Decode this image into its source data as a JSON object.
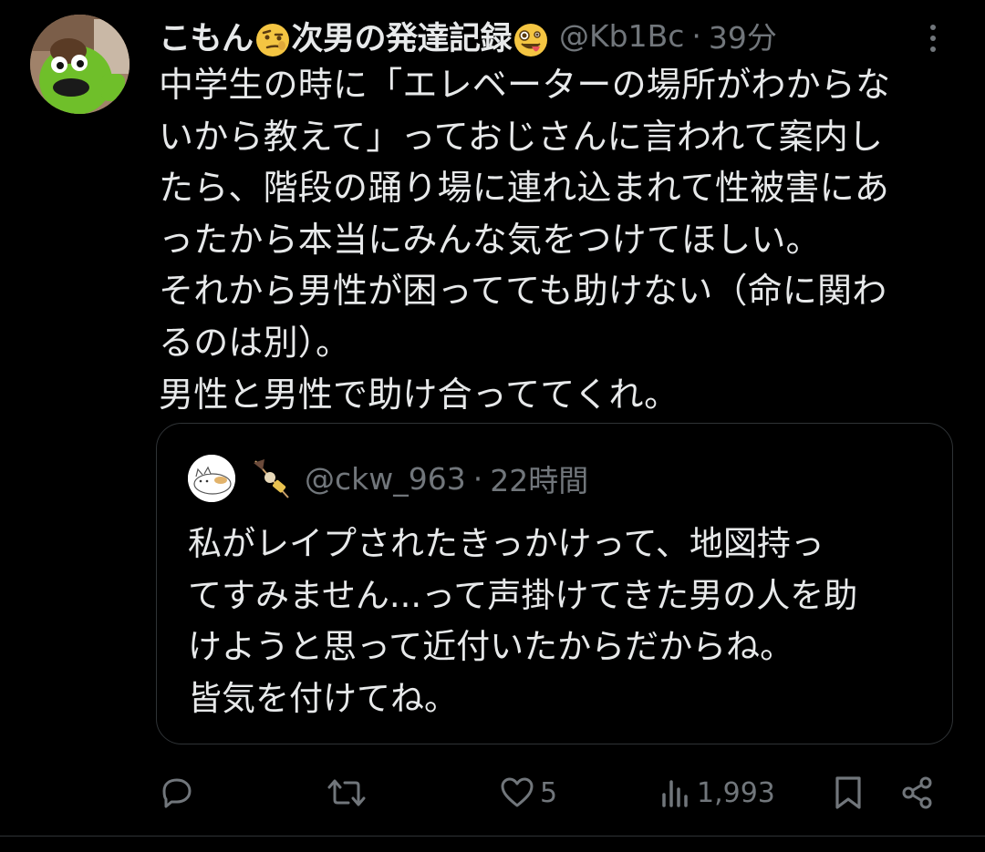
{
  "post": {
    "author": {
      "name_part1": "こもん",
      "name_part2": "次男の発達記録",
      "handle": "@Kb1Bc",
      "separator": "·",
      "time": "39分"
    },
    "text_lines": [
      "中学生の時に「エレベーターの場所がわからな",
      "いから教えて」っておじさんに言われて案内し",
      "たら、階段の踊り場に連れ込まれて性被害にあ",
      "ったから本当にみんな気をつけてほしい。",
      "それから男性が困ってても助けない（命に関わ",
      "るのは別）。",
      "男性と男性で助け合っててくれ。"
    ],
    "quote": {
      "handle": "@ckw_963",
      "separator": "·",
      "time": "22時間",
      "text_lines": [
        "私がレイプされたきっかけって、地図持っ",
        "てすみません...って声掛けてきた男の人を助",
        "けようと思って近付いたからだからね。",
        "皆気を付けてね。"
      ]
    },
    "actions": {
      "reply_count": "",
      "repost_count": "",
      "like_count": "5",
      "views_count": "1,993"
    }
  },
  "icons": {
    "avatar": "green-puppet-avatar-icon",
    "name_emoji_1": "raised-eyebrow-face-icon",
    "name_emoji_2": "zany-face-icon",
    "more": "more-vertical-icon",
    "quote_avatar": "cat-avatar-icon",
    "quote_emoji": "oden-skewer-icon",
    "reply": "reply-icon",
    "repost": "repost-icon",
    "like": "heart-icon",
    "views": "views-icon",
    "bookmark": "bookmark-icon",
    "share": "share-icon"
  },
  "colors": {
    "background": "#000000",
    "text": "#e7e9ea",
    "muted": "#71767b",
    "border": "#2f3336"
  }
}
